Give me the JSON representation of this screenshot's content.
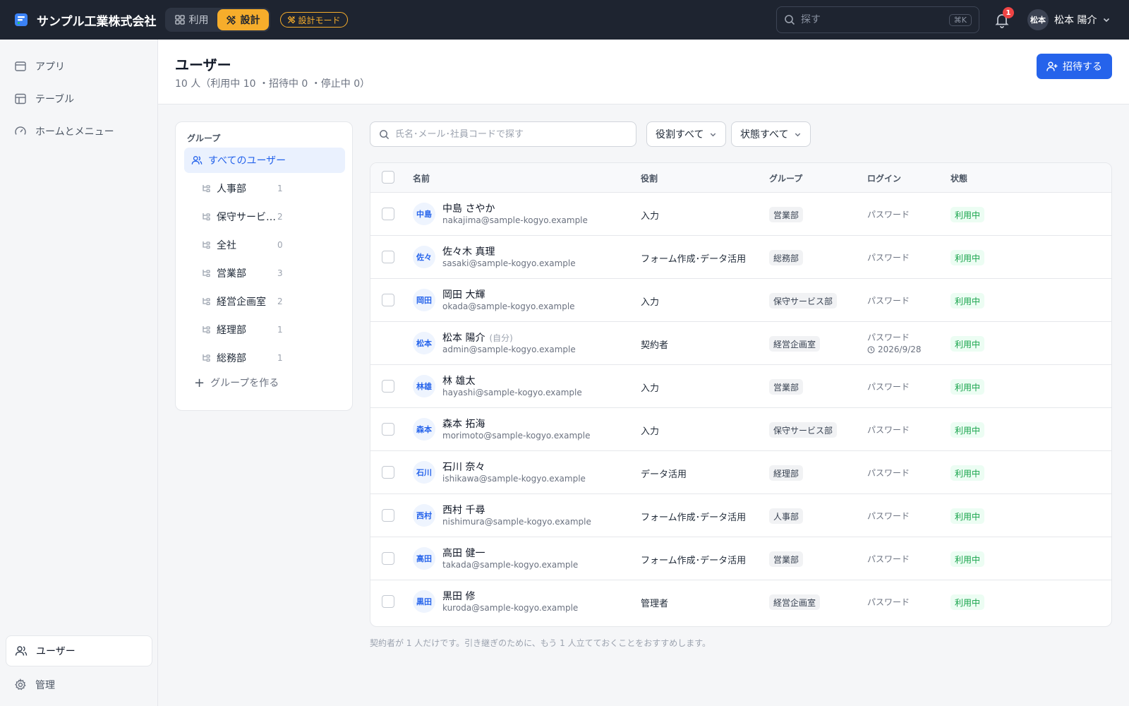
{
  "app": {
    "company": "サンプル工業株式会社",
    "mode_use": "利用",
    "mode_design": "設計",
    "mode_badge": "設計モード",
    "search_placeholder": "探す",
    "search_shortcut": "⌘K",
    "notification_count": "1",
    "user_initials": "松本",
    "user_name": "松本 陽介"
  },
  "sidebar": {
    "items": [
      {
        "label": "アプリ",
        "icon": "app-window-icon"
      },
      {
        "label": "テーブル",
        "icon": "table-icon"
      },
      {
        "label": "ホームとメニュー",
        "icon": "gauge-icon"
      }
    ],
    "bottom": [
      {
        "label": "ユーザー",
        "icon": "users-icon",
        "active": true
      },
      {
        "label": "管理",
        "icon": "gear-icon"
      }
    ]
  },
  "page": {
    "title": "ユーザー",
    "subtitle": "10 人（利用中 10 ・招待中 0 ・停止中 0）",
    "invite_label": "招待する"
  },
  "groups": {
    "title": "グループ",
    "all_label": "すべてのユーザー",
    "items": [
      {
        "name": "人事部",
        "count": "1"
      },
      {
        "name": "保守サービス部",
        "count": "2"
      },
      {
        "name": "全社",
        "count": "0"
      },
      {
        "name": "営業部",
        "count": "3"
      },
      {
        "name": "経営企画室",
        "count": "2"
      },
      {
        "name": "経理部",
        "count": "1"
      },
      {
        "name": "総務部",
        "count": "1"
      }
    ],
    "add_label": "グループを作る"
  },
  "filters": {
    "search_placeholder": "氏名･メール･社員コードで探す",
    "role_label": "役割すべて",
    "status_label": "状態すべて"
  },
  "table": {
    "headers": {
      "name": "名前",
      "role": "役割",
      "group": "グループ",
      "login": "ログイン",
      "status": "状態"
    },
    "rows": [
      {
        "initials": "中島",
        "name": "中島 さやか",
        "email": "nakajima@sample-kogyo.example",
        "role": "入力",
        "group": "営業部",
        "login": "パスワード",
        "status": "利用中"
      },
      {
        "initials": "佐々",
        "name": "佐々木 真理",
        "email": "sasaki@sample-kogyo.example",
        "role": "フォーム作成･データ活用",
        "group": "総務部",
        "login": "パスワード",
        "status": "利用中"
      },
      {
        "initials": "岡田",
        "name": "岡田 大輝",
        "email": "okada@sample-kogyo.example",
        "role": "入力",
        "group": "保守サービス部",
        "login": "パスワード",
        "status": "利用中"
      },
      {
        "initials": "松本",
        "name": "松本 陽介",
        "self": "(自分)",
        "email": "admin@sample-kogyo.example",
        "role": "契約者",
        "group": "経営企画室",
        "login": "パスワード",
        "login_date": "2026/9/28",
        "status": "利用中"
      },
      {
        "initials": "林雄",
        "name": "林 雄太",
        "email": "hayashi@sample-kogyo.example",
        "role": "入力",
        "group": "営業部",
        "login": "パスワード",
        "status": "利用中"
      },
      {
        "initials": "森本",
        "name": "森本 拓海",
        "email": "morimoto@sample-kogyo.example",
        "role": "入力",
        "group": "保守サービス部",
        "login": "パスワード",
        "status": "利用中"
      },
      {
        "initials": "石川",
        "name": "石川 奈々",
        "email": "ishikawa@sample-kogyo.example",
        "role": "データ活用",
        "group": "経理部",
        "login": "パスワード",
        "status": "利用中"
      },
      {
        "initials": "西村",
        "name": "西村 千尋",
        "email": "nishimura@sample-kogyo.example",
        "role": "フォーム作成･データ活用",
        "group": "人事部",
        "login": "パスワード",
        "status": "利用中"
      },
      {
        "initials": "高田",
        "name": "高田 健一",
        "email": "takada@sample-kogyo.example",
        "role": "フォーム作成･データ活用",
        "group": "営業部",
        "login": "パスワード",
        "status": "利用中"
      },
      {
        "initials": "黒田",
        "name": "黒田 修",
        "email": "kuroda@sample-kogyo.example",
        "role": "管理者",
        "group": "経営企画室",
        "login": "パスワード",
        "status": "利用中"
      }
    ]
  },
  "footnote": "契約者が 1 人だけです。引き継ぎのために、もう 1 人立てておくことをおすすめします。",
  "colors": {
    "topbar": "#1e2430",
    "accent": "#f6ad2b",
    "primary": "#2563eb",
    "status_active": "#16a34a"
  }
}
